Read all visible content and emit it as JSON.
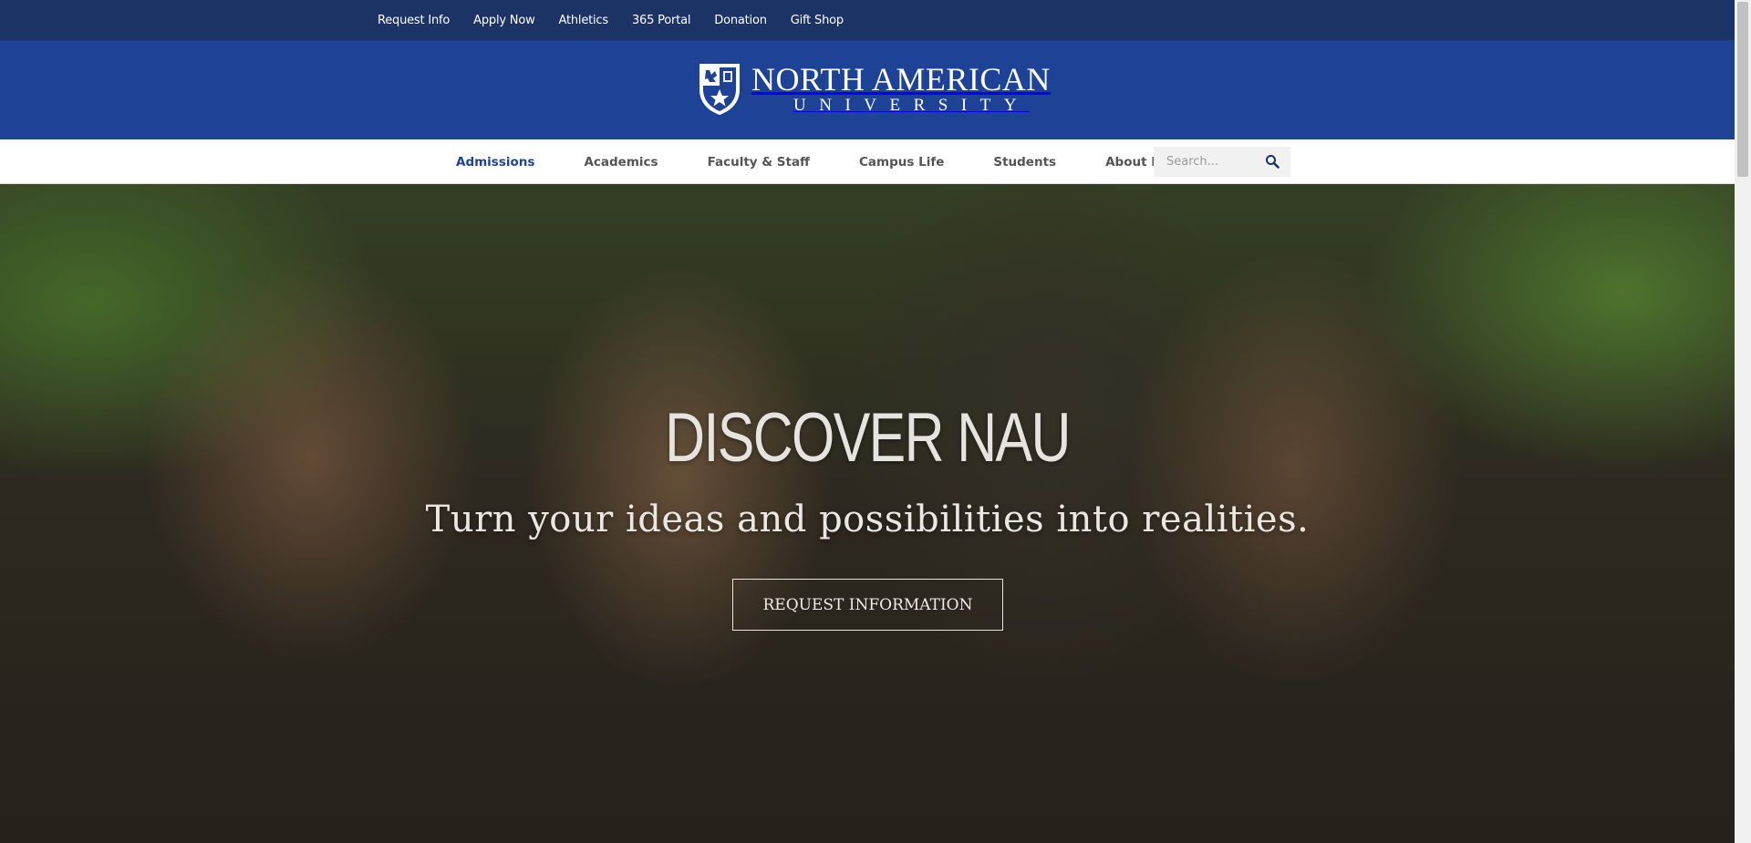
{
  "utility_nav": {
    "links": [
      "Request Info",
      "Apply Now",
      "Athletics",
      "365 Portal",
      "Donation",
      "Gift Shop"
    ]
  },
  "logo": {
    "line1": "NORTH AMERICAN",
    "line2": "UNIVERSITY"
  },
  "main_nav": {
    "items": [
      "Admissions",
      "Academics",
      "Faculty & Staff",
      "Campus Life",
      "Students",
      "About NAU"
    ],
    "active": "Admissions"
  },
  "search": {
    "placeholder": "Search..."
  },
  "hero": {
    "title": "DISCOVER NAU",
    "subtitle": "Turn your ideas and possibilities into realities.",
    "button_label": "REQUEST INFORMATION"
  },
  "colors": {
    "topbar": "#1c3366",
    "header": "#1d4296",
    "nav_active": "#1d4296"
  }
}
